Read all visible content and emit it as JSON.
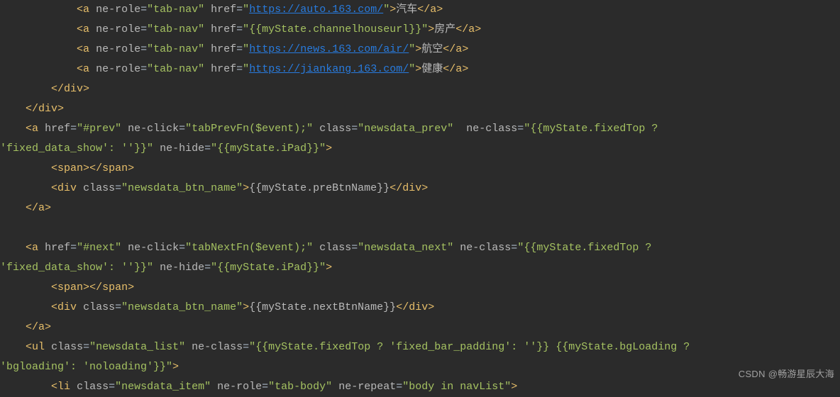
{
  "lines": [
    {
      "indent": 12,
      "segments": [
        {
          "t": "bracket",
          "v": "<"
        },
        {
          "t": "tag",
          "v": "a"
        },
        {
          "t": "text",
          "v": " "
        },
        {
          "t": "attr",
          "v": "ne-role"
        },
        {
          "t": "eq",
          "v": "="
        },
        {
          "t": "str",
          "v": "\"tab-nav\""
        },
        {
          "t": "text",
          "v": " "
        },
        {
          "t": "attr",
          "v": "href"
        },
        {
          "t": "eq",
          "v": "="
        },
        {
          "t": "str",
          "v": "\""
        },
        {
          "t": "link",
          "v": "https://auto.163.com/"
        },
        {
          "t": "str",
          "v": "\""
        },
        {
          "t": "bracket",
          "v": ">"
        },
        {
          "t": "text",
          "v": "汽车"
        },
        {
          "t": "bracket",
          "v": "</"
        },
        {
          "t": "tag",
          "v": "a"
        },
        {
          "t": "bracket",
          "v": ">"
        }
      ]
    },
    {
      "indent": 12,
      "segments": [
        {
          "t": "bracket",
          "v": "<"
        },
        {
          "t": "tag",
          "v": "a"
        },
        {
          "t": "text",
          "v": " "
        },
        {
          "t": "attr",
          "v": "ne-role"
        },
        {
          "t": "eq",
          "v": "="
        },
        {
          "t": "str",
          "v": "\"tab-nav\""
        },
        {
          "t": "text",
          "v": " "
        },
        {
          "t": "attr",
          "v": "href"
        },
        {
          "t": "eq",
          "v": "="
        },
        {
          "t": "str",
          "v": "\"{{myState.channelhouseurl}}\""
        },
        {
          "t": "bracket",
          "v": ">"
        },
        {
          "t": "text",
          "v": "房产"
        },
        {
          "t": "bracket",
          "v": "</"
        },
        {
          "t": "tag",
          "v": "a"
        },
        {
          "t": "bracket",
          "v": ">"
        }
      ]
    },
    {
      "indent": 12,
      "segments": [
        {
          "t": "bracket",
          "v": "<"
        },
        {
          "t": "tag",
          "v": "a"
        },
        {
          "t": "text",
          "v": " "
        },
        {
          "t": "attr",
          "v": "ne-role"
        },
        {
          "t": "eq",
          "v": "="
        },
        {
          "t": "str",
          "v": "\"tab-nav\""
        },
        {
          "t": "text",
          "v": " "
        },
        {
          "t": "attr",
          "v": "href"
        },
        {
          "t": "eq",
          "v": "="
        },
        {
          "t": "str",
          "v": "\""
        },
        {
          "t": "link",
          "v": "https://news.163.com/air/"
        },
        {
          "t": "str",
          "v": "\""
        },
        {
          "t": "bracket",
          "v": ">"
        },
        {
          "t": "text",
          "v": "航空"
        },
        {
          "t": "bracket",
          "v": "</"
        },
        {
          "t": "tag",
          "v": "a"
        },
        {
          "t": "bracket",
          "v": ">"
        }
      ]
    },
    {
      "indent": 12,
      "segments": [
        {
          "t": "bracket",
          "v": "<"
        },
        {
          "t": "tag",
          "v": "a"
        },
        {
          "t": "text",
          "v": " "
        },
        {
          "t": "attr",
          "v": "ne-role"
        },
        {
          "t": "eq",
          "v": "="
        },
        {
          "t": "str",
          "v": "\"tab-nav\""
        },
        {
          "t": "text",
          "v": " "
        },
        {
          "t": "attr",
          "v": "href"
        },
        {
          "t": "eq",
          "v": "="
        },
        {
          "t": "str",
          "v": "\""
        },
        {
          "t": "link",
          "v": "https://jiankang.163.com/"
        },
        {
          "t": "str",
          "v": "\""
        },
        {
          "t": "bracket",
          "v": ">"
        },
        {
          "t": "text",
          "v": "健康"
        },
        {
          "t": "bracket",
          "v": "</"
        },
        {
          "t": "tag",
          "v": "a"
        },
        {
          "t": "bracket",
          "v": ">"
        }
      ]
    },
    {
      "indent": 8,
      "segments": [
        {
          "t": "bracket",
          "v": "</"
        },
        {
          "t": "tag",
          "v": "div"
        },
        {
          "t": "bracket",
          "v": ">"
        }
      ]
    },
    {
      "indent": 4,
      "segments": [
        {
          "t": "bracket",
          "v": "</"
        },
        {
          "t": "tag",
          "v": "div"
        },
        {
          "t": "bracket",
          "v": ">"
        }
      ]
    },
    {
      "indent": 4,
      "segments": [
        {
          "t": "bracket",
          "v": "<"
        },
        {
          "t": "tag",
          "v": "a"
        },
        {
          "t": "text",
          "v": " "
        },
        {
          "t": "attr",
          "v": "href"
        },
        {
          "t": "eq",
          "v": "="
        },
        {
          "t": "str",
          "v": "\"#prev\""
        },
        {
          "t": "text",
          "v": " "
        },
        {
          "t": "attr",
          "v": "ne-click"
        },
        {
          "t": "eq",
          "v": "="
        },
        {
          "t": "str",
          "v": "\"tabPrevFn($event);\""
        },
        {
          "t": "text",
          "v": " "
        },
        {
          "t": "attr",
          "v": "class"
        },
        {
          "t": "eq",
          "v": "="
        },
        {
          "t": "str",
          "v": "\"newsdata_prev\""
        },
        {
          "t": "text",
          "v": "  "
        },
        {
          "t": "attr",
          "v": "ne-class"
        },
        {
          "t": "eq",
          "v": "="
        },
        {
          "t": "str",
          "v": "\"{{myState.fixedTop ?"
        }
      ]
    },
    {
      "indent": 0,
      "segments": [
        {
          "t": "str",
          "v": "'fixed_data_show': ''}}\""
        },
        {
          "t": "text",
          "v": " "
        },
        {
          "t": "attr",
          "v": "ne-hide"
        },
        {
          "t": "eq",
          "v": "="
        },
        {
          "t": "str",
          "v": "\"{{myState.iPad}}\""
        },
        {
          "t": "bracket",
          "v": ">"
        }
      ]
    },
    {
      "indent": 8,
      "segments": [
        {
          "t": "bracket",
          "v": "<"
        },
        {
          "t": "tag",
          "v": "span"
        },
        {
          "t": "bracket",
          "v": ">"
        },
        {
          "t": "bracket",
          "v": "</"
        },
        {
          "t": "tag",
          "v": "span"
        },
        {
          "t": "bracket",
          "v": ">"
        }
      ]
    },
    {
      "indent": 8,
      "segments": [
        {
          "t": "bracket",
          "v": "<"
        },
        {
          "t": "tag",
          "v": "div"
        },
        {
          "t": "text",
          "v": " "
        },
        {
          "t": "attr",
          "v": "class"
        },
        {
          "t": "eq",
          "v": "="
        },
        {
          "t": "str",
          "v": "\"newsdata_btn_name\""
        },
        {
          "t": "bracket",
          "v": ">"
        },
        {
          "t": "text",
          "v": "{{myState.preBtnName}}"
        },
        {
          "t": "bracket",
          "v": "</"
        },
        {
          "t": "tag",
          "v": "div"
        },
        {
          "t": "bracket",
          "v": ">"
        }
      ]
    },
    {
      "indent": 4,
      "segments": [
        {
          "t": "bracket",
          "v": "</"
        },
        {
          "t": "tag",
          "v": "a"
        },
        {
          "t": "bracket",
          "v": ">"
        }
      ]
    },
    {
      "indent": 0,
      "segments": []
    },
    {
      "indent": 4,
      "segments": [
        {
          "t": "bracket",
          "v": "<"
        },
        {
          "t": "tag",
          "v": "a"
        },
        {
          "t": "text",
          "v": " "
        },
        {
          "t": "attr",
          "v": "href"
        },
        {
          "t": "eq",
          "v": "="
        },
        {
          "t": "str",
          "v": "\"#next\""
        },
        {
          "t": "text",
          "v": " "
        },
        {
          "t": "attr",
          "v": "ne-click"
        },
        {
          "t": "eq",
          "v": "="
        },
        {
          "t": "str",
          "v": "\"tabNextFn($event);\""
        },
        {
          "t": "text",
          "v": " "
        },
        {
          "t": "attr",
          "v": "class"
        },
        {
          "t": "eq",
          "v": "="
        },
        {
          "t": "str",
          "v": "\"newsdata_next\""
        },
        {
          "t": "text",
          "v": " "
        },
        {
          "t": "attr",
          "v": "ne-class"
        },
        {
          "t": "eq",
          "v": "="
        },
        {
          "t": "str",
          "v": "\"{{myState.fixedTop ?"
        }
      ]
    },
    {
      "indent": 0,
      "segments": [
        {
          "t": "str",
          "v": "'fixed_data_show': ''}}\""
        },
        {
          "t": "text",
          "v": " "
        },
        {
          "t": "attr",
          "v": "ne-hide"
        },
        {
          "t": "eq",
          "v": "="
        },
        {
          "t": "str",
          "v": "\"{{myState.iPad}}\""
        },
        {
          "t": "bracket",
          "v": ">"
        }
      ]
    },
    {
      "indent": 8,
      "segments": [
        {
          "t": "bracket",
          "v": "<"
        },
        {
          "t": "tag",
          "v": "span"
        },
        {
          "t": "bracket",
          "v": ">"
        },
        {
          "t": "bracket",
          "v": "</"
        },
        {
          "t": "tag",
          "v": "span"
        },
        {
          "t": "bracket",
          "v": ">"
        }
      ]
    },
    {
      "indent": 8,
      "segments": [
        {
          "t": "bracket",
          "v": "<"
        },
        {
          "t": "tag",
          "v": "div"
        },
        {
          "t": "text",
          "v": " "
        },
        {
          "t": "attr",
          "v": "class"
        },
        {
          "t": "eq",
          "v": "="
        },
        {
          "t": "str",
          "v": "\"newsdata_btn_name\""
        },
        {
          "t": "bracket",
          "v": ">"
        },
        {
          "t": "text",
          "v": "{{myState.nextBtnName}}"
        },
        {
          "t": "bracket",
          "v": "</"
        },
        {
          "t": "tag",
          "v": "div"
        },
        {
          "t": "bracket",
          "v": ">"
        }
      ]
    },
    {
      "indent": 4,
      "segments": [
        {
          "t": "bracket",
          "v": "</"
        },
        {
          "t": "tag",
          "v": "a"
        },
        {
          "t": "bracket",
          "v": ">"
        }
      ]
    },
    {
      "indent": 4,
      "segments": [
        {
          "t": "bracket",
          "v": "<"
        },
        {
          "t": "tag",
          "v": "ul"
        },
        {
          "t": "text",
          "v": " "
        },
        {
          "t": "attr",
          "v": "class"
        },
        {
          "t": "eq",
          "v": "="
        },
        {
          "t": "str",
          "v": "\"newsdata_list\""
        },
        {
          "t": "text",
          "v": " "
        },
        {
          "t": "attr",
          "v": "ne-class"
        },
        {
          "t": "eq",
          "v": "="
        },
        {
          "t": "str",
          "v": "\"{{myState.fixedTop ? 'fixed_bar_padding': ''}} {{myState.bgLoading ?"
        }
      ]
    },
    {
      "indent": 0,
      "segments": [
        {
          "t": "str",
          "v": "'bgloading': 'noloading'}}\""
        },
        {
          "t": "bracket",
          "v": ">"
        }
      ]
    },
    {
      "indent": 8,
      "segments": [
        {
          "t": "bracket",
          "v": "<"
        },
        {
          "t": "tag",
          "v": "li"
        },
        {
          "t": "text",
          "v": " "
        },
        {
          "t": "attr",
          "v": "class"
        },
        {
          "t": "eq",
          "v": "="
        },
        {
          "t": "str",
          "v": "\"newsdata_item\""
        },
        {
          "t": "text",
          "v": " "
        },
        {
          "t": "attr",
          "v": "ne-role"
        },
        {
          "t": "eq",
          "v": "="
        },
        {
          "t": "str",
          "v": "\"tab-body\""
        },
        {
          "t": "text",
          "v": " "
        },
        {
          "t": "attr",
          "v": "ne-repeat"
        },
        {
          "t": "eq",
          "v": "="
        },
        {
          "t": "str",
          "v": "\"body in navList\""
        },
        {
          "t": "bracket",
          "v": ">"
        }
      ]
    }
  ],
  "watermark": "CSDN @畅游星辰大海"
}
